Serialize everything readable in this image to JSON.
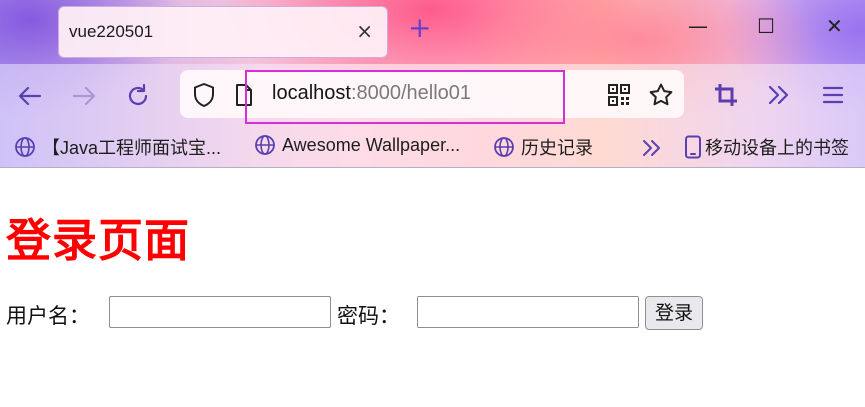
{
  "browser": {
    "tab": {
      "title": "vue220501",
      "close_glyph": "×"
    },
    "new_tab_glyph": "+",
    "window_controls": {
      "minimize": "—",
      "maximize": "☐",
      "close": "✕"
    },
    "url": {
      "host": "localhost",
      "path": ":8000/hello01"
    },
    "bookmarks": [
      {
        "label": "【Java工程师面试宝...",
        "icon": "globe-icon"
      },
      {
        "label": "Awesome Wallpaper...",
        "icon": "globe-icon"
      },
      {
        "label": "历史记录",
        "icon": "globe-icon"
      }
    ],
    "bookmarks_overflow": "»",
    "mobile_bookmarks": "移动设备上的书签",
    "colors": {
      "accent": "#6b3fc8",
      "url_highlight": "#d42fd8"
    }
  },
  "page": {
    "title": "登录页面",
    "title_color": "#ff0000",
    "form": {
      "username_label": "用户名：",
      "username_value": "",
      "password_label": "密码：",
      "password_value": "",
      "submit_label": "登录"
    }
  }
}
